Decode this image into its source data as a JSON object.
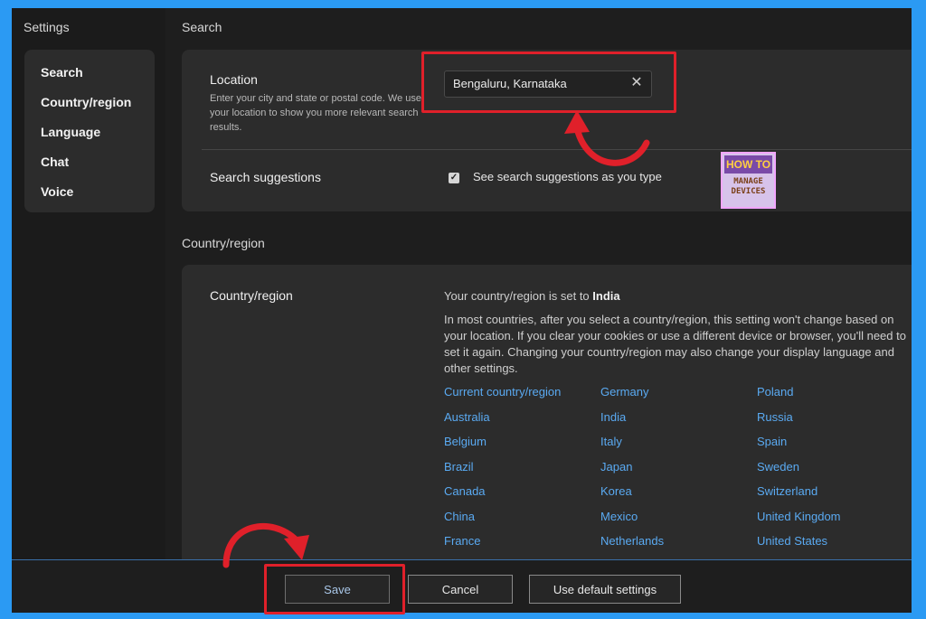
{
  "settings_title": "Settings",
  "sidebar": {
    "items": [
      {
        "label": "Search"
      },
      {
        "label": "Country/region"
      },
      {
        "label": "Language"
      },
      {
        "label": "Chat"
      },
      {
        "label": "Voice"
      }
    ]
  },
  "search_section": {
    "title": "Search",
    "location": {
      "label": "Location",
      "description": "Enter your city and state or postal code. We use your location to show you more relevant search results.",
      "value": "Bengaluru, Karnataka",
      "clear_icon": "close-icon"
    },
    "suggestions": {
      "label": "Search suggestions",
      "checkbox_label": "See search suggestions as you type",
      "checked": true
    }
  },
  "logo": {
    "line1": "HOW TO",
    "line2": "MANAGE DEVICES"
  },
  "country_section": {
    "title": "Country/region",
    "row_label": "Country/region",
    "status_prefix": "Your country/region is set to ",
    "status_country": "India",
    "explanation": "In most countries, after you select a country/region, this setting won't change based on your location. If you clear your cookies or use a different device or browser, you'll need to set it again. Changing your country/region may also change your display language and other settings.",
    "links": [
      "Current country/region",
      "Germany",
      "Poland",
      "Australia",
      "India",
      "Russia",
      "Belgium",
      "Italy",
      "Spain",
      "Brazil",
      "Japan",
      "Sweden",
      "Canada",
      "Korea",
      "Switzerland",
      "China",
      "Mexico",
      "United Kingdom",
      "France",
      "Netherlands",
      "United States"
    ]
  },
  "footer": {
    "save_label": "Save",
    "cancel_label": "Cancel",
    "default_label": "Use default settings"
  },
  "colors": {
    "accent_link": "#5aaaf2",
    "highlight_red": "#e0202a",
    "frame_blue": "#2b9af3"
  }
}
